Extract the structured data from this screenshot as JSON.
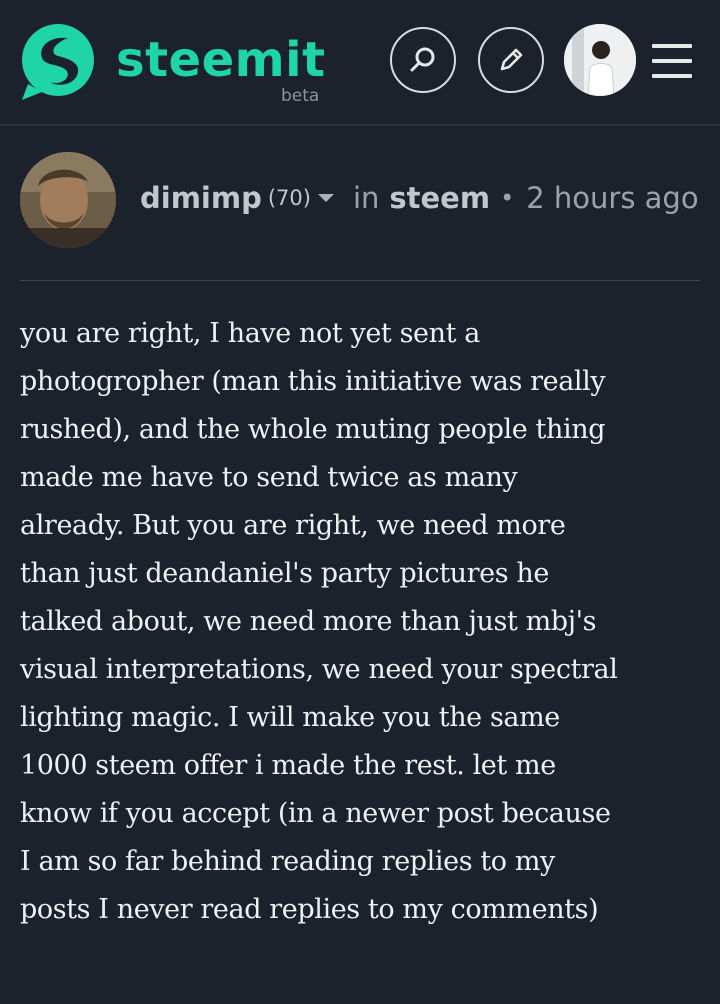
{
  "header": {
    "logo_text": "steemit",
    "logo_badge": "beta",
    "icons": {
      "logo": "steemit-logo-icon",
      "search": "search-icon",
      "edit": "pencil-icon",
      "menu": "hamburger-menu-icon"
    },
    "brand_color": "#1fd5a8"
  },
  "post": {
    "author": "dimimp",
    "reputation": "(70)",
    "in_label": "in",
    "category": "steem",
    "separator": "•",
    "timestamp": "2 hours ago",
    "body": "you are right, I have not yet sent a\nphotogropher (man this initiative was really\nrushed), and the whole muting people thing\nmade me have to send twice as many\nalready. But you are right, we need more\nthan just deandaniel's party pictures he\ntalked about, we need more than just mbj's\nvisual interpretations, we need your spectral\nlighting magic. I will make you the same\n1000 steem offer i made the rest. let me\nknow if you accept (in a newer post because\nI am so far behind reading replies to my\nposts I never read replies to my comments)"
  }
}
